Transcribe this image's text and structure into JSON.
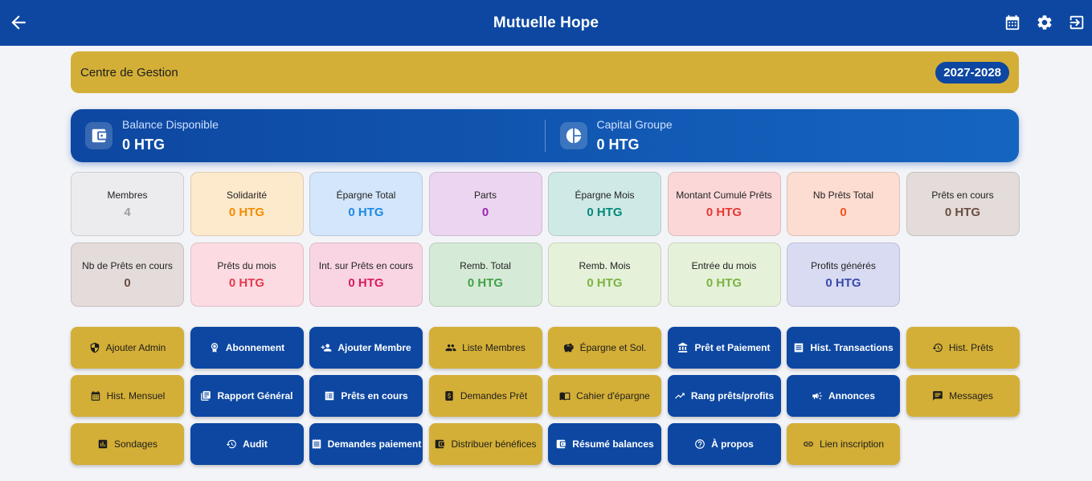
{
  "app": {
    "title": "Mutuelle Hope"
  },
  "icons": {
    "back": "arrow-left-icon",
    "calendar": "calendar-icon",
    "settings": "gear-icon",
    "logout": "logout-icon"
  },
  "header": {
    "label": "Centre de Gestion",
    "year": "2027-2028"
  },
  "balance": {
    "available_label": "Balance Disponible",
    "available_value": "0 HTG",
    "capital_label": "Capital Groupe",
    "capital_value": "0 HTG"
  },
  "stats": [
    {
      "label": "Membres",
      "value": "4",
      "color": "#9e9e9e",
      "bg": "#ececee"
    },
    {
      "label": "Solidarité",
      "value": "0 HTG",
      "color": "#f28c00",
      "bg": "#fde9cc"
    },
    {
      "label": "Épargne Total",
      "value": "0 HTG",
      "color": "#1e88e5",
      "bg": "#d3e6fb"
    },
    {
      "label": "Parts",
      "value": "0",
      "color": "#9c27b0",
      "bg": "#ecd5f0"
    },
    {
      "label": "Épargne Mois",
      "value": "0 HTG",
      "color": "#00897b",
      "bg": "#cfe9e7"
    },
    {
      "label": "Montant Cumulé Prêts",
      "value": "0 HTG",
      "color": "#e53935",
      "bg": "#fbd7d7"
    },
    {
      "label": "Nb Prêts Total",
      "value": "0",
      "color": "#f4511e",
      "bg": "#fddcd1"
    },
    {
      "label": "Prêts en cours",
      "value": "0 HTG",
      "color": "#6d4c41",
      "bg": "#e3dcda"
    },
    {
      "label": "Nb de Prêts en cours",
      "value": "0",
      "color": "#6d4c41",
      "bg": "#e3dcda"
    },
    {
      "label": "Prêts du mois",
      "value": "0 HTG",
      "color": "#e53950",
      "bg": "#fcdce2"
    },
    {
      "label": "Int. sur Prêts en cours",
      "value": "0 HTG",
      "color": "#d81b60",
      "bg": "#f9d5e3"
    },
    {
      "label": "Remb. Total",
      "value": "0 HTG",
      "color": "#43a047",
      "bg": "#d6ebd7"
    },
    {
      "label": "Remb. Mois",
      "value": "0 HTG",
      "color": "#7cb342",
      "bg": "#e5f1d9"
    },
    {
      "label": "Entrée du mois",
      "value": "0 HTG",
      "color": "#7cb342",
      "bg": "#e5f1d9"
    },
    {
      "label": "Profits générés",
      "value": "0 HTG",
      "color": "#3949ab",
      "bg": "#d8dbf2"
    }
  ],
  "buttons": [
    {
      "label": "Ajouter Admin",
      "style": "gold",
      "icon": "admin-shield-icon"
    },
    {
      "label": "Abonnement",
      "style": "blue",
      "icon": "badge-icon"
    },
    {
      "label": "Ajouter Membre",
      "style": "blue",
      "icon": "person-add-icon"
    },
    {
      "label": "Liste Membres",
      "style": "gold",
      "icon": "people-icon"
    },
    {
      "label": "Épargne et Sol.",
      "style": "gold",
      "icon": "piggy-bank-icon"
    },
    {
      "label": "Prêt et Paiement",
      "style": "blue",
      "icon": "bank-icon"
    },
    {
      "label": "Hist. Transactions",
      "style": "blue",
      "icon": "receipt-icon"
    },
    {
      "label": "Hist. Prêts",
      "style": "gold",
      "icon": "history-icon"
    },
    {
      "label": "Hist. Mensuel",
      "style": "gold",
      "icon": "calendar-icon"
    },
    {
      "label": "Rapport Général",
      "style": "blue",
      "icon": "report-icon"
    },
    {
      "label": "Prêts en cours",
      "style": "blue",
      "icon": "list-icon"
    },
    {
      "label": "Demandes Prêt",
      "style": "gold",
      "icon": "request-money-icon"
    },
    {
      "label": "Cahier d'épargne",
      "style": "gold",
      "icon": "book-icon"
    },
    {
      "label": "Rang prêts/profits",
      "style": "blue",
      "icon": "trending-up-icon"
    },
    {
      "label": "Annonces",
      "style": "blue",
      "icon": "megaphone-icon"
    },
    {
      "label": "Messages",
      "style": "gold",
      "icon": "message-icon"
    },
    {
      "label": "Sondages",
      "style": "gold",
      "icon": "poll-icon"
    },
    {
      "label": "Audit",
      "style": "blue",
      "icon": "audit-history-icon"
    },
    {
      "label": "Demandes paiement",
      "style": "blue",
      "icon": "receipt-icon"
    },
    {
      "label": "Distribuer bénéfices",
      "style": "gold",
      "icon": "wallet-icon"
    },
    {
      "label": "Résumé balances",
      "style": "blue",
      "icon": "wallet-icon"
    },
    {
      "label": "À propos",
      "style": "blue",
      "icon": "help-icon"
    },
    {
      "label": "Lien inscription",
      "style": "gold",
      "icon": "link-icon"
    }
  ]
}
